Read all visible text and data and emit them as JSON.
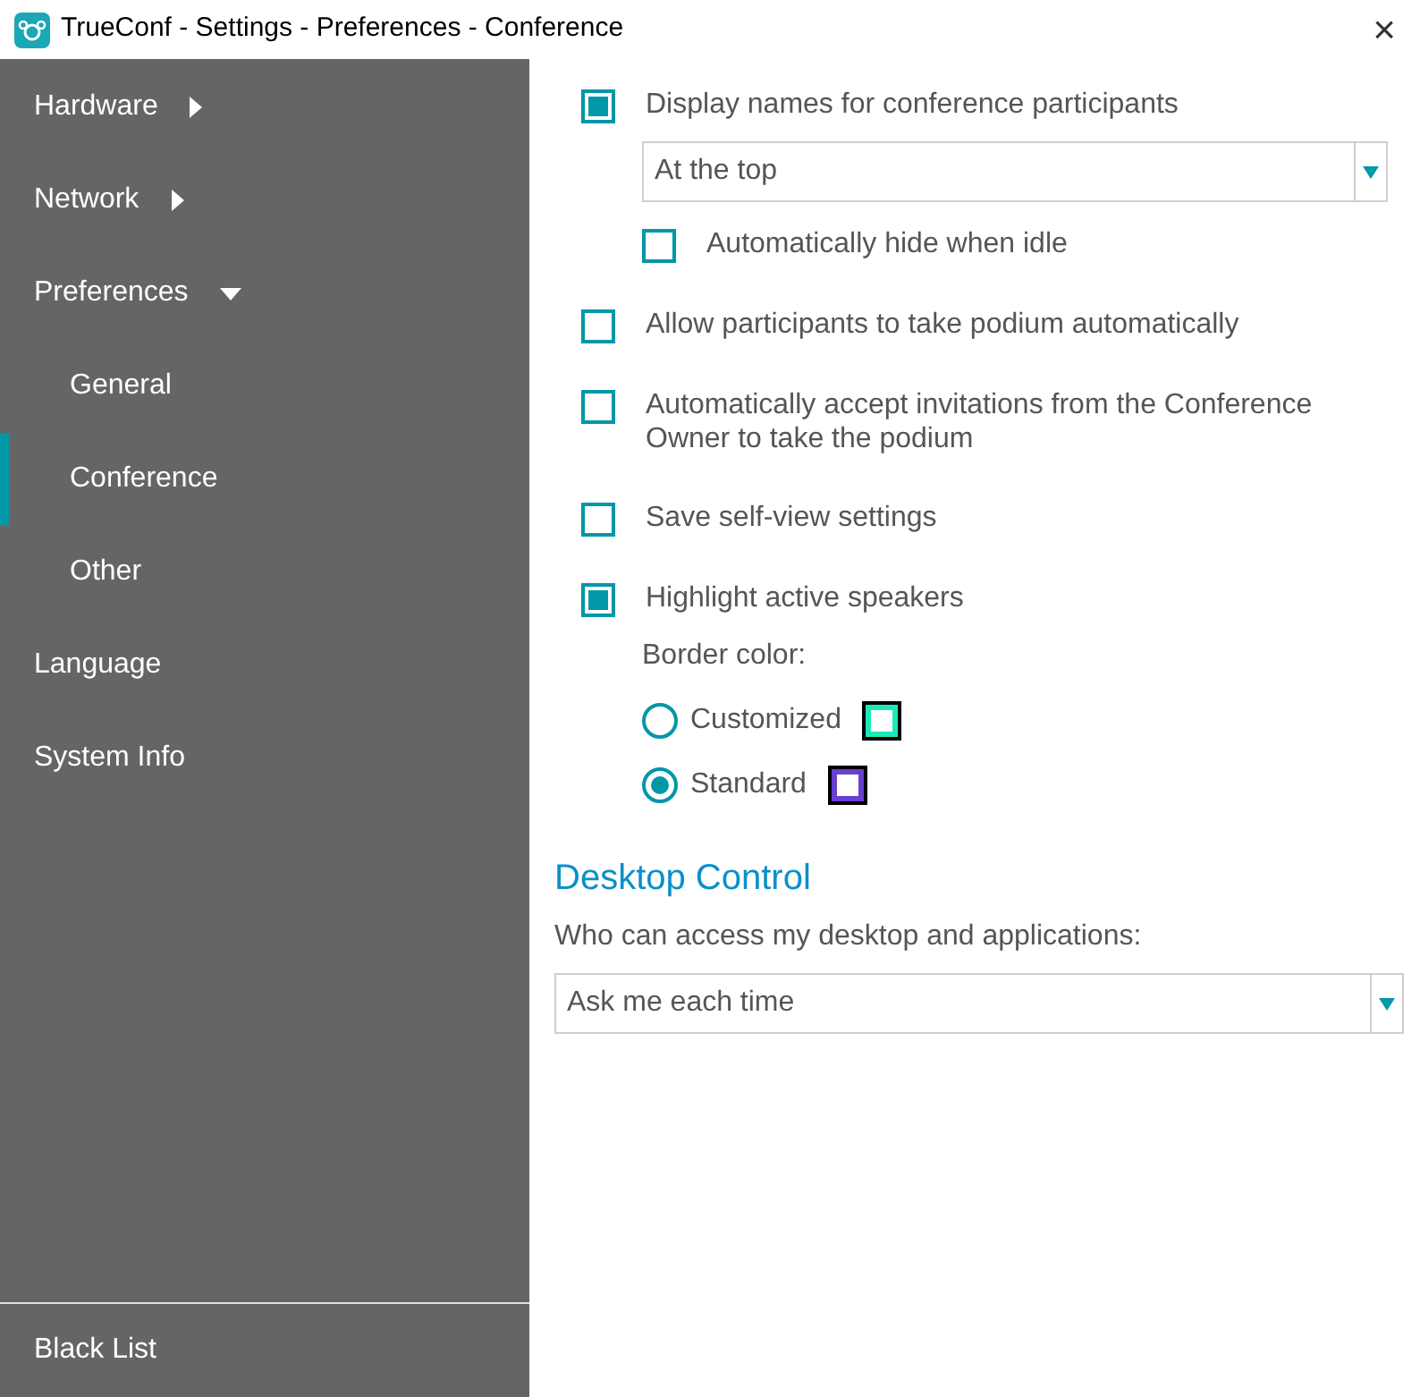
{
  "window": {
    "title": "TrueConf - Settings - Preferences - Conference",
    "close": "×"
  },
  "sidebar": {
    "items": [
      {
        "label": "Hardware",
        "expanded": false,
        "selected": false
      },
      {
        "label": "Network",
        "expanded": false,
        "selected": false
      },
      {
        "label": "Preferences",
        "expanded": true,
        "selected": false,
        "children": [
          {
            "label": "General",
            "selected": false
          },
          {
            "label": "Conference",
            "selected": true
          },
          {
            "label": "Other",
            "selected": false
          }
        ]
      },
      {
        "label": "Language",
        "selected": false
      },
      {
        "label": "System Info",
        "selected": false
      }
    ],
    "bottom_items": [
      {
        "label": "Black List",
        "selected": false
      }
    ]
  },
  "settings": [
    {
      "kind": "checkbox",
      "label": "Display names for conference participants",
      "checked": true,
      "children": [
        {
          "kind": "dropdown",
          "value": "At the top"
        },
        {
          "kind": "checkbox",
          "label": "Automatically hide when idle",
          "checked": false
        }
      ]
    },
    {
      "kind": "checkbox",
      "label": "Allow participants to take podium automatically",
      "checked": false
    },
    {
      "kind": "checkbox",
      "label": "Automatically accept invitations from the Conference Owner to take the podium",
      "checked": false
    },
    {
      "kind": "checkbox",
      "label": "Save self-view settings",
      "checked": false
    },
    {
      "kind": "checkbox",
      "label": "Highlight active speakers",
      "checked": true,
      "children": [
        {
          "kind": "label",
          "text": "Border color:"
        },
        {
          "kind": "radio",
          "label": "Customized",
          "selected": false,
          "color": "#1de9b6"
        },
        {
          "kind": "radio",
          "label": "Standard",
          "selected": true,
          "color": "#6a3fd0"
        }
      ]
    }
  ],
  "desktop_control": {
    "heading": "Desktop Control",
    "label": "Who can access my desktop and applications:",
    "dropdown": {
      "value": "Ask me each time"
    }
  }
}
